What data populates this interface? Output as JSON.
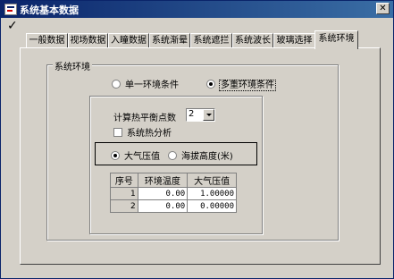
{
  "window": {
    "title": "系统基本数据"
  },
  "check_mark": "✓",
  "tabs": [
    {
      "label": "一般数据"
    },
    {
      "label": "视场数据"
    },
    {
      "label": "入瞳数据"
    },
    {
      "label": "系统渐晕"
    },
    {
      "label": "系统遮拦"
    },
    {
      "label": "系统波长"
    },
    {
      "label": "玻璃选择"
    },
    {
      "label": "系统环境",
      "active": true
    }
  ],
  "env_group": {
    "label": "系统环境",
    "single_option": "单一环境条件",
    "multi_option": "多重环境条件",
    "selected": "multi"
  },
  "calc": {
    "points_label": "计算热平衡点数",
    "points_value": "2",
    "thermal_analysis_label": "系统热分析",
    "thermal_analysis_checked": false
  },
  "pressure_mode": {
    "atm_label": "大气压值",
    "altitude_label": "海拔高度(米)",
    "selected": "atm"
  },
  "table": {
    "headers": [
      "序号",
      "环境温度",
      "大气压值"
    ],
    "rows": [
      [
        "1",
        "0.00",
        "1.00000"
      ],
      [
        "2",
        "0.00",
        "0.00000"
      ]
    ]
  }
}
